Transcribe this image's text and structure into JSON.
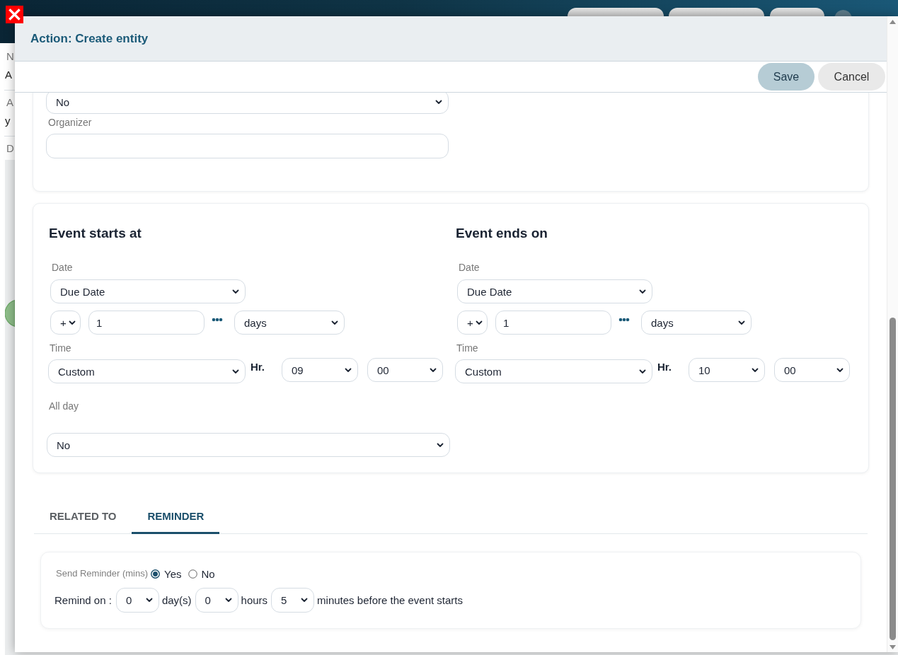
{
  "background_page": {
    "fields": [
      {
        "label": "N",
        "value": "A"
      },
      {
        "label": "A",
        "value": "y"
      },
      {
        "label": "D"
      }
    ]
  },
  "dialog": {
    "title": "Action: Create entity",
    "buttons": [
      {
        "label": "Save",
        "kind": "primary"
      },
      {
        "label": "Cancel",
        "kind": "secondary"
      }
    ],
    "top_section": {
      "fields": [
        {
          "kind": "select",
          "value": "No"
        },
        {
          "kind": "input",
          "label": "Organizer"
        }
      ]
    },
    "event_sections": [
      {
        "title": "Event starts at",
        "date_label": "Date",
        "date_source": "Due Date",
        "offset_sign": "+",
        "offset_amount": "1",
        "offset_unit": "days",
        "time_label": "Time",
        "time_mode": "Custom",
        "hour_label": "Hr.",
        "hour": "09",
        "minute": "00",
        "all_day_label": "All day",
        "all_day": "No"
      },
      {
        "title": "Event ends on",
        "date_label": "Date",
        "date_source": "Due Date",
        "offset_sign": "+",
        "offset_amount": "1",
        "offset_unit": "days",
        "time_label": "Time",
        "time_mode": "Custom",
        "hour_label": "Hr.",
        "hour": "10",
        "minute": "00"
      }
    ],
    "tabs": [
      {
        "label": "RELATED TO",
        "selected": false
      },
      {
        "label": "REMINDER",
        "selected": true
      }
    ],
    "reminder": {
      "send_label": "Send Reminder (mins)",
      "options": [
        {
          "label": "Yes",
          "selected": true
        },
        {
          "label": "No",
          "selected": false
        }
      ],
      "remind_on_label": "Remind on :",
      "parts": [
        {
          "value": "0",
          "unit": "day(s)"
        },
        {
          "value": "0",
          "unit": "hours"
        },
        {
          "value": "5",
          "unit": "minutes before the event starts"
        }
      ]
    }
  }
}
